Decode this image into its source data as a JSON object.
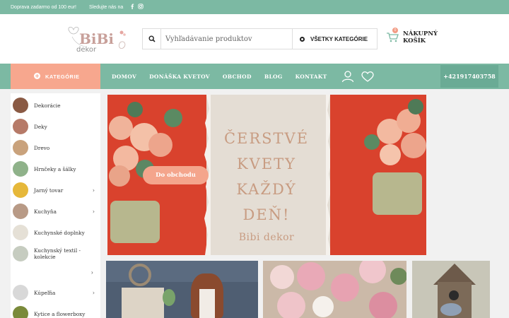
{
  "topbar": {
    "promo": "Doprava zadarmo od 100 eur!",
    "social_label": "Sledujte nás na",
    "social_icons": [
      "facebook-icon",
      "instagram-icon"
    ]
  },
  "header": {
    "logo_text_top": "BiBi",
    "logo_text_bottom": "dekor",
    "search_placeholder": "Vyhľadávanie produktov",
    "categories_dropdown": "VŠETKY KATEGÓRIE",
    "cart_badge": "0",
    "cart_line1": "NÁKUPNÝ",
    "cart_line2": "KOŠÍK"
  },
  "nav": {
    "categories_button": "KATEGÓRIE",
    "links": [
      "DOMOV",
      "DONÁŠKA KVETOV",
      "OBCHOD",
      "BLOG",
      "KONTAKT"
    ],
    "phone": "+421917403758"
  },
  "sidebar": {
    "items": [
      {
        "label": "Dekorácie",
        "thumb_color": "#8a5a44",
        "arrow": false
      },
      {
        "label": "Deky",
        "thumb_color": "#b67a68",
        "arrow": false
      },
      {
        "label": "Drevo",
        "thumb_color": "#c9a27c",
        "arrow": false
      },
      {
        "label": "Hrnčeky a šálky",
        "thumb_color": "#8fb28a",
        "arrow": false
      },
      {
        "label": "Jarný tovar",
        "thumb_color": "#e6b83a",
        "arrow": true
      },
      {
        "label": "Kuchyňa",
        "thumb_color": "#b89a86",
        "arrow": true
      },
      {
        "label": "Kuchynské doplnky",
        "thumb_color": "#e5e0d6",
        "arrow": false
      },
      {
        "label": "Kuchynský textil - kolekcie",
        "thumb_color": "#c6ccc0",
        "arrow": false
      },
      {
        "label": "Kúpeľňa",
        "thumb_color": "#d8d8d8",
        "arrow": true
      },
      {
        "label": "Kytice a flowerboxy",
        "thumb_color": "#7a8a3a",
        "arrow": false
      }
    ],
    "more_arrow": "›"
  },
  "hero": {
    "headline_lines": [
      "ČERSTVÉ",
      "KVETY",
      "KAŽDÝ DEŇ!"
    ],
    "brand": "Bibi dekor",
    "cta": "Do obchodu"
  },
  "colors": {
    "accent_green": "#7cb9a3",
    "accent_peach": "#f7a78e",
    "hero_text": "#c89c82"
  }
}
